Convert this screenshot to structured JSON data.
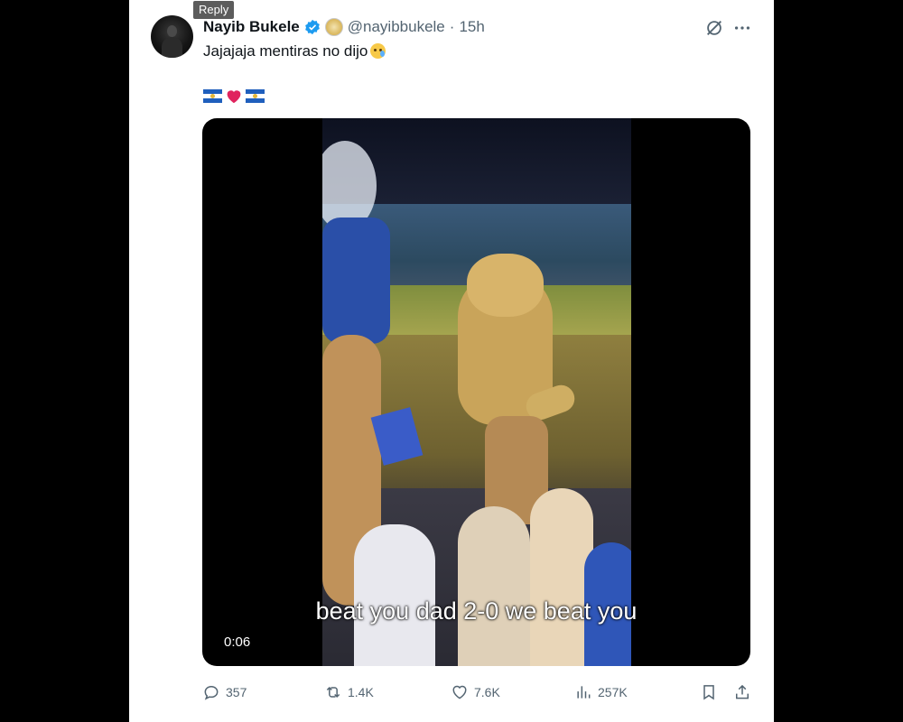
{
  "tooltip": {
    "label": "Reply"
  },
  "author": {
    "display_name": "Nayib Bukele",
    "handle": "@nayibbukele",
    "separator": "·",
    "time": "15h"
  },
  "tweet": {
    "text": "Jajajaja mentiras no dijo",
    "text_emoji": "face-holding-back-tears",
    "emoji_line": [
      "flag-el-salvador",
      "red-heart",
      "flag-el-salvador"
    ]
  },
  "video": {
    "caption": "beat you dad 2-0 we beat you",
    "timestamp": "0:06"
  },
  "metrics": {
    "replies": "357",
    "reposts": "1.4K",
    "likes": "7.6K",
    "views": "257K"
  },
  "colors": {
    "verified": "#1d9bf0",
    "text_secondary": "#536471",
    "text_primary": "#0f1419"
  }
}
